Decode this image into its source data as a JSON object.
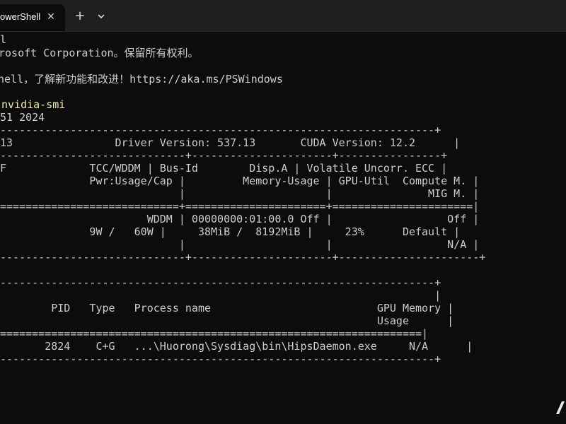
{
  "window": {
    "tab_title": "owerShell",
    "tab_close_icon": "close-icon",
    "new_tab_icon": "plus-icon",
    "dropdown_icon": "chevron-down-icon"
  },
  "colors": {
    "background": "#0c0c0c",
    "text": "#cccccc",
    "command": "#f2eea8",
    "tabbar": "#1f1f1f"
  },
  "terminal": {
    "lines": [
      "l",
      "rosoft Corporation。保留所有权利。",
      "hell，了解新功能和改进！https://aka.ms/PSWindows",
      "nvidia-smi",
      "51 2024",
      "--------------------------------------------------------------------+",
      "13                Driver Version: 537.13       CUDA Version: 12.2      |",
      "-----------------------------+----------------------+----------------+",
      "F             TCC/WDDM | Bus-Id        Disp.A | Volatile Uncorr. ECC |",
      "              Pwr:Usage/Cap |         Memory-Usage | GPU-Util  Compute M. |",
      "                            |                      |               MIG M. |",
      "============================+======================+======================|",
      "                       WDDM | 00000000:01:00.0 Off |                  Off |",
      "              9W /   60W |     38MiB /  8192MiB |     23%      Default |",
      "                            |                      |                  N/A |",
      "-----------------------------+----------------------+----------------------+",
      "",
      "--------------------------------------------------------------------+",
      "                                                                    |",
      "        PID   Type   Process name                          GPU Memory |",
      "                                                           Usage      |",
      "==================================================================|",
      "       2824    C+G   ...\\Huorong\\Sysdiag\\bin\\HipsDaemon.exe     N/A      |",
      "--------------------------------------------------------------------+"
    ]
  }
}
